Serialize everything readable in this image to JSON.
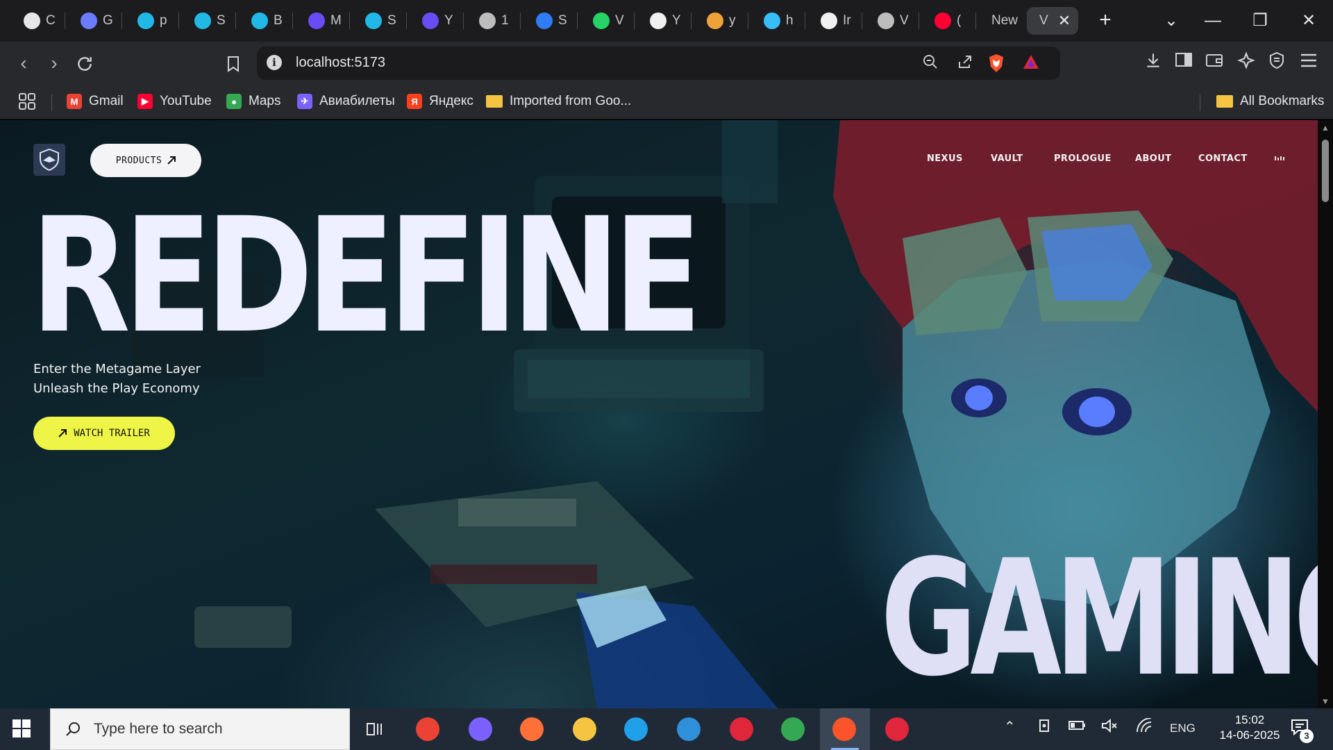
{
  "tabs": [
    {
      "icon": "openai-icon",
      "label": "C",
      "color": "#e6e6e6"
    },
    {
      "icon": "gemini-icon",
      "label": "G",
      "color": "#6b7cff"
    },
    {
      "icon": "canva-icon",
      "label": "p",
      "color": "#21b8e8"
    },
    {
      "icon": "canva-icon",
      "label": "S",
      "color": "#21b8e8"
    },
    {
      "icon": "canva-icon",
      "label": "B",
      "color": "#21b8e8"
    },
    {
      "icon": "video-icon",
      "label": "M",
      "color": "#6a4cf5"
    },
    {
      "icon": "canva-icon",
      "label": "S",
      "color": "#21b8e8"
    },
    {
      "icon": "video-icon",
      "label": "Y",
      "color": "#6a4cf5"
    },
    {
      "icon": "globe-icon",
      "label": "1",
      "color": "#bdbdbd"
    },
    {
      "icon": "swirl-icon",
      "label": "S",
      "color": "#2f7cf6"
    },
    {
      "icon": "whatsapp-icon",
      "label": "V",
      "color": "#25d366"
    },
    {
      "icon": "github-icon",
      "label": "Y",
      "color": "#f0f0f0"
    },
    {
      "icon": "amazon-icon",
      "label": "y",
      "color": "#f0a23a"
    },
    {
      "icon": "tailwind-icon",
      "label": "h",
      "color": "#38bdf8"
    },
    {
      "icon": "github-icon",
      "label": "Ir",
      "color": "#f0f0f0"
    },
    {
      "icon": "globe-icon",
      "label": "V",
      "color": "#bdbdbd"
    },
    {
      "icon": "youtube-icon",
      "label": "(",
      "color": "#ff0033"
    },
    {
      "icon": "",
      "label": "New",
      "color": ""
    }
  ],
  "active_tab": {
    "label": "V",
    "close": "✕"
  },
  "new_tab": "+",
  "window": {
    "dropdown": "⌄",
    "minimize": "—",
    "restore": "❐",
    "close": "✕"
  },
  "address": {
    "url": "localhost:5173",
    "info": "i"
  },
  "bookmarks": [
    {
      "label": "Gmail",
      "icon": "gmail-icon",
      "color": "#ea4335",
      "glyph": "M"
    },
    {
      "label": "YouTube",
      "icon": "youtube-icon",
      "color": "#ff0033",
      "glyph": "▶"
    },
    {
      "label": "Maps",
      "icon": "maps-icon",
      "color": "#34a853",
      "glyph": "●"
    },
    {
      "label": "Авиабилеты",
      "icon": "aviasales-icon",
      "color": "#7b61ff",
      "glyph": "✈"
    },
    {
      "label": "Яндекс",
      "icon": "yandex-icon",
      "color": "#fc3f1d",
      "glyph": "Я"
    },
    {
      "label": "Imported from Goo...",
      "icon": "folder-icon",
      "color": "#f5c542",
      "glyph": ""
    }
  ],
  "all_bookmarks": "All Bookmarks",
  "site": {
    "products_label": "PRODUCTS",
    "nav": [
      "NEXUS",
      "VAULT",
      "PROLOGUE",
      "ABOUT",
      "CONTACT"
    ],
    "headline": "REDEFINE",
    "sub1": "Enter the Metagame Layer",
    "sub2": "Unleash the Play Economy",
    "trailer_label": "WATCH TRAILER",
    "footer_word": "GAMING",
    "accent": "#eef546"
  },
  "taskbar": {
    "search_placeholder": "Type here to search",
    "apps": [
      "chrome-icon",
      "copilot-icon",
      "firefox-icon",
      "file-explorer-icon",
      "edge-icon",
      "vscode-icon",
      "opera-icon",
      "chrome-profile-icon",
      "brave-icon",
      "app-icon"
    ],
    "lang": "ENG",
    "time": "15:02",
    "date": "14-06-2025",
    "notifications": "3"
  }
}
